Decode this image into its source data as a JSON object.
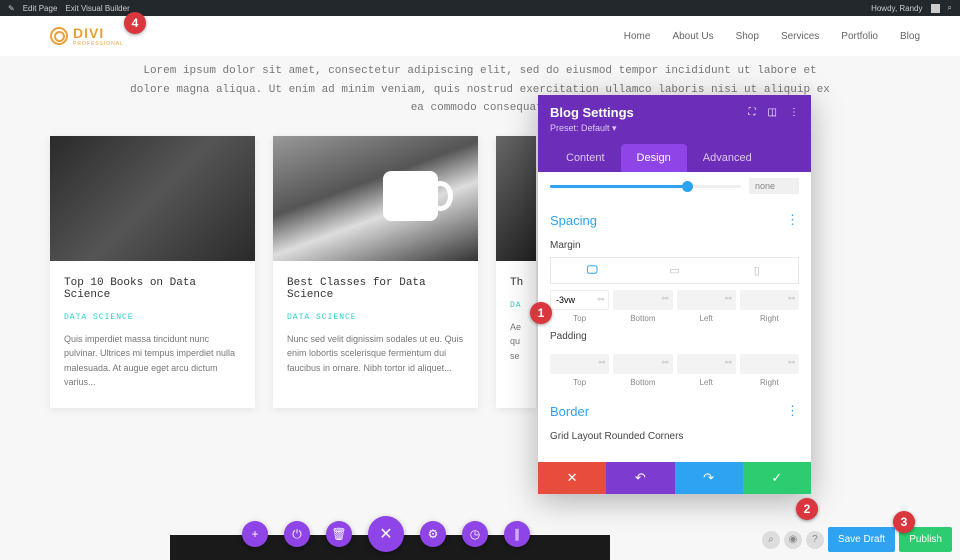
{
  "adminBar": {
    "editPage": "Edit Page",
    "exitBuilder": "Exit Visual Builder",
    "greeting": "Howdy, Randy"
  },
  "logo": {
    "name": "DIVI",
    "sub": "PROFESSIONAL"
  },
  "nav": {
    "items": [
      "Home",
      "About Us",
      "Shop",
      "Services",
      "Portfolio",
      "Blog"
    ]
  },
  "intro": "Lorem ipsum dolor sit amet, consectetur adipiscing elit, sed do eiusmod tempor incididunt ut labore et dolore magna aliqua. Ut enim ad minim veniam, quis nostrud exercitation ullamco laboris nisi ut aliquip ex ea commodo consequat.",
  "cards": [
    {
      "title": "Top 10 Books on Data Science",
      "cat": "DATA SCIENCE",
      "text": "Quis imperdiet massa tincidunt nunc pulvinar. Ultrices mi tempus imperdiet nulla malesuada. At augue eget arcu dictum varius..."
    },
    {
      "title": "Best Classes for Data Science",
      "cat": "DATA SCIENCE",
      "text": "Nunc sed velit dignissim sodales ut eu. Quis enim lobortis scelerisque fermentum dui faucibus in ornare. Nibh tortor id aliquet..."
    },
    {
      "title": "Th",
      "cat": "DA",
      "text": "Ae qu se"
    }
  ],
  "panel": {
    "title": "Blog Settings",
    "preset": "Preset: Default ▾",
    "tabs": [
      "Content",
      "Design",
      "Advanced"
    ],
    "slider_val": "none",
    "spacing": {
      "title": "Spacing",
      "margin_label": "Margin",
      "padding_label": "Padding",
      "top_val": "-3vw",
      "sides": [
        "Top",
        "Bottom",
        "Left",
        "Right"
      ]
    },
    "border": {
      "title": "Border",
      "rounded_label": "Grid Layout Rounded Corners"
    }
  },
  "bottomRight": {
    "saveDraft": "Save Draft",
    "publish": "Publish"
  },
  "badges": {
    "b1": "1",
    "b2": "2",
    "b3": "3",
    "b4": "4"
  }
}
